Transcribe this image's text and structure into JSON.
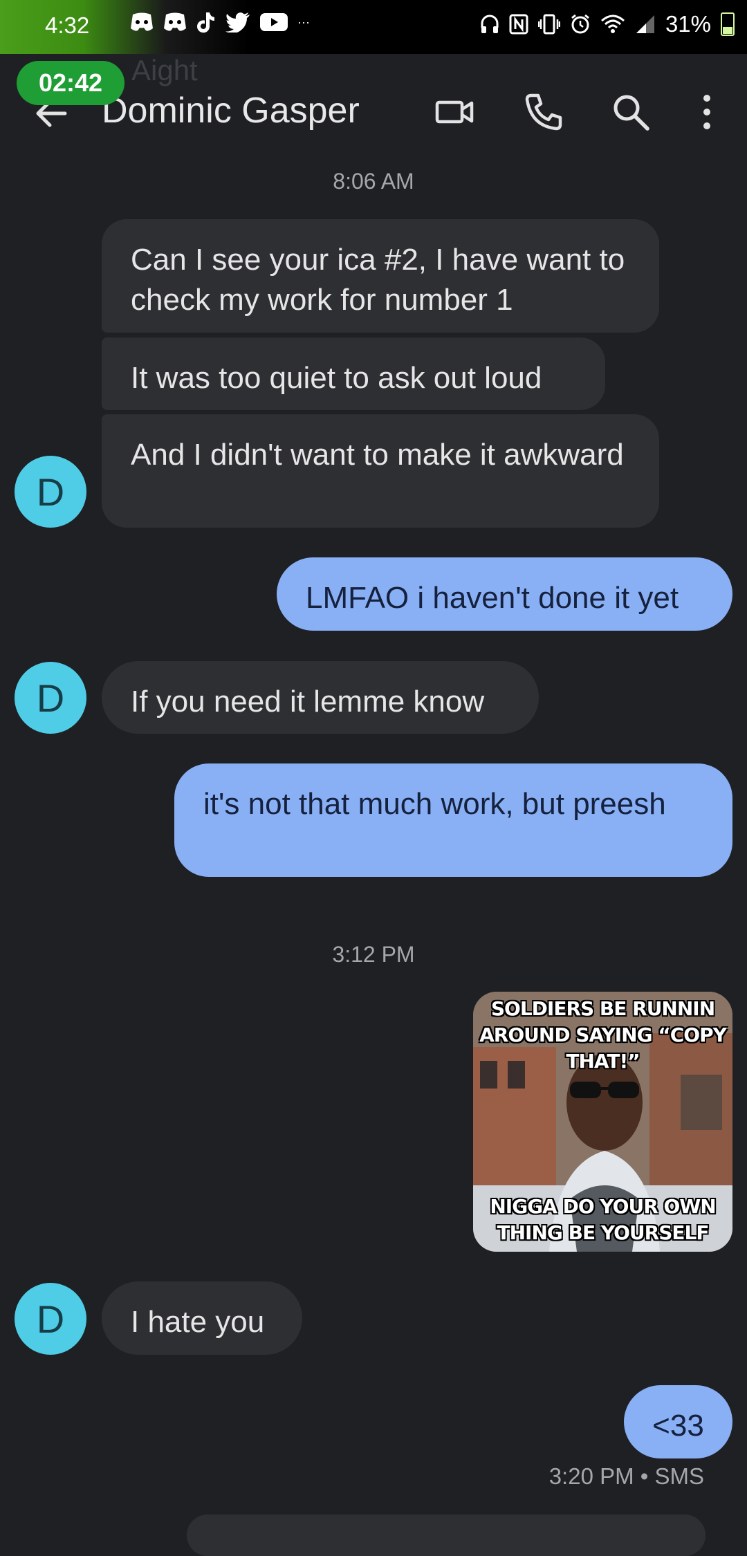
{
  "status_bar": {
    "time": "4:32",
    "battery": "31%",
    "more_indicator": "···",
    "app_icons": [
      "discord-icon",
      "discord-icon",
      "tiktok-icon",
      "twitter-icon",
      "youtube-icon"
    ],
    "system_icons": [
      "headphones-icon",
      "nfc-icon",
      "vibrate-icon",
      "alarm-icon",
      "wifi-icon",
      "signal-icon",
      "battery-icon"
    ]
  },
  "call_timer": "02:42",
  "ghost_preview": "Aight",
  "header": {
    "contact_name": "Dominic Gasper",
    "actions": [
      "video-call-icon",
      "phone-icon",
      "search-icon",
      "more-vert-icon"
    ]
  },
  "conversation": {
    "timestamp_1": "8:06 AM",
    "msg_1": "Can I see your ica #2, I have want to check my work for number 1",
    "msg_2": "It was too quiet to ask out loud",
    "msg_3": "And I didn't want to make it awkward",
    "msg_4": "LMFAO i haven't done it yet",
    "msg_5": "If you need it lemme know",
    "msg_6": "it's not that much work, but preesh",
    "timestamp_2": "3:12 PM",
    "meme_top": "SOLDIERS BE RUNNIN AROUND SAYING “COPY THAT!”",
    "meme_bottom": "NIGGA DO YOUR OWN THING BE YOURSELF",
    "msg_7": "I hate you",
    "msg_8": "<33",
    "last_meta": "3:20 PM • SMS",
    "avatar_letter": "D"
  },
  "colors": {
    "background": "#1f2024",
    "incoming_bubble": "#2e2f33",
    "outgoing_bubble": "#89aff5",
    "avatar": "#4fcde6",
    "call_pill": "#1f9e35"
  }
}
